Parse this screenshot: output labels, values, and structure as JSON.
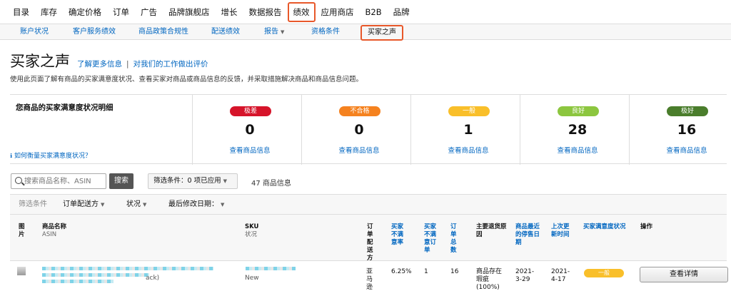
{
  "topnav": {
    "items": [
      "目录",
      "库存",
      "确定价格",
      "订单",
      "广告",
      "品牌旗舰店",
      "增长",
      "数据报告",
      "绩效",
      "应用商店",
      "B2B",
      "品牌"
    ]
  },
  "subnav": {
    "items": [
      "账户状况",
      "客户服务绩效",
      "商品政策合规性",
      "配送绩效",
      "报告",
      "资格条件",
      "买家之声"
    ]
  },
  "header": {
    "title": "买家之声",
    "learn_more": "了解更多信息",
    "separator": "|",
    "feedback": "对我们的工作做出评价",
    "description": "使用此页面了解有商品的买家满意度状况、查看买家对商品或商品信息的反馈，并采取措施解决商品和商品信息问题。"
  },
  "summary": {
    "title": "您商品的买家满意度状况明细",
    "help_link": "如何衡量买家满意度状况？",
    "cards": [
      {
        "label": "极差",
        "count": "0",
        "link": "查看商品信息",
        "color": "#d6142a"
      },
      {
        "label": "不合格",
        "count": "0",
        "link": "查看商品信息",
        "color": "#f5821f"
      },
      {
        "label": "一般",
        "count": "1",
        "link": "查看商品信息",
        "color": "#f9bf2a"
      },
      {
        "label": "良好",
        "count": "28",
        "link": "查看商品信息",
        "color": "#8cc63f"
      },
      {
        "label": "极好",
        "count": "16",
        "link": "查看商品信息",
        "color": "#4a7d2c"
      }
    ]
  },
  "toolbar": {
    "search_placeholder": "搜索商品名称、ASIN",
    "search_button": "搜索",
    "filter_label": "筛选条件：0 项已应用",
    "count_label": "47 商品信息"
  },
  "filters": {
    "label": "筛选条件",
    "items": [
      "订单配送方",
      "状况",
      "最后修改日期："
    ]
  },
  "table": {
    "headers": [
      {
        "label": "图片",
        "sub": ""
      },
      {
        "label": "商品名称",
        "sub": "ASIN"
      },
      {
        "label": "SKU",
        "sub": "状况"
      },
      {
        "label": "订单配送方",
        "sub": ""
      },
      {
        "label": "买家不满意率",
        "sub": ""
      },
      {
        "label": "买家不满意订单",
        "sub": ""
      },
      {
        "label": "订单总数",
        "sub": ""
      },
      {
        "label": "主要退货原因",
        "sub": ""
      },
      {
        "label": "商品最近的停售日期",
        "sub": ""
      },
      {
        "label": "上次更新时间",
        "sub": ""
      },
      {
        "label": "买家满意度状况",
        "sub": ""
      },
      {
        "label": "操作",
        "sub": ""
      }
    ],
    "row": {
      "sku_tail": "ack)",
      "condition": "New",
      "fulfillment": "亚马逊",
      "rate": "6.25%",
      "dissat_orders": "1",
      "total_orders": "16",
      "return_reason": "商品存在瑕疵",
      "return_pct": "(100%)",
      "stop_date": "2021-3-29",
      "update_date": "2021-4-17",
      "status": "一般",
      "action": "查看详情"
    }
  },
  "colors": {
    "link": "#0066c0",
    "highlight": "#e8582a"
  }
}
